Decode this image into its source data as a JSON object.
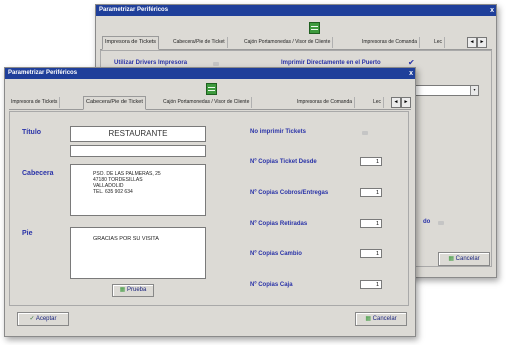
{
  "back_window": {
    "title": "Parametrizar Periféricos",
    "close": "x",
    "tabs": [
      "Impresora de Tickets",
      "Cabecera/Pie de Ticket",
      "Cajón Portamonedas / Visor de Cliente",
      "Impresoras de Comanda",
      "Lec"
    ],
    "arrows": [
      "◄",
      "►"
    ],
    "utilizar_drivers": "Utilizar Drivers Impresora",
    "imprimir_directamente": "Imprimir Directamente en el Puerto",
    "combo_arrow": "▾",
    "fragment_label": "do",
    "cancel_label": "Cancelar"
  },
  "front_window": {
    "title": "Parametrizar Periféricos",
    "close": "x",
    "tabs": [
      "Impresora de Tickets",
      "Cabecera/Pie de Ticket",
      "Cajón Portamonedas / Visor de Cliente",
      "Impresoras de Comanda",
      "Lec"
    ],
    "arrows": [
      "◄",
      "►"
    ],
    "titulo_label": "Título",
    "titulo_value": "RESTAURANTE",
    "cabecera_label": "Cabecera",
    "cabecera_text": "PSO. DE LAS PALMERAS, 25\n47180 TORDESILLAS\nVALLADOLID\nTEL. 635 902 634",
    "pie_label": "Pie",
    "pie_text": "GRACIAS POR SU VISITA",
    "prueba_label": "Prueba",
    "no_imprimir_label": "No imprimir Tickets",
    "copias": [
      {
        "label": "Nº Copias Ticket Desde",
        "value": "1"
      },
      {
        "label": "Nº Copias Cobros/Entregas",
        "value": "1"
      },
      {
        "label": "Nº Copias Retiradas",
        "value": "1"
      },
      {
        "label": "Nº Copias Cambio",
        "value": "1"
      },
      {
        "label": "Nº Copias Caja",
        "value": "1"
      }
    ],
    "aceptar_label": "Aceptar",
    "cancelar_label": "Cancelar"
  },
  "colors": {
    "titlebar": "#1f3f9a",
    "label_blue": "#2a33a8",
    "window_bg": "#dcdad5"
  }
}
